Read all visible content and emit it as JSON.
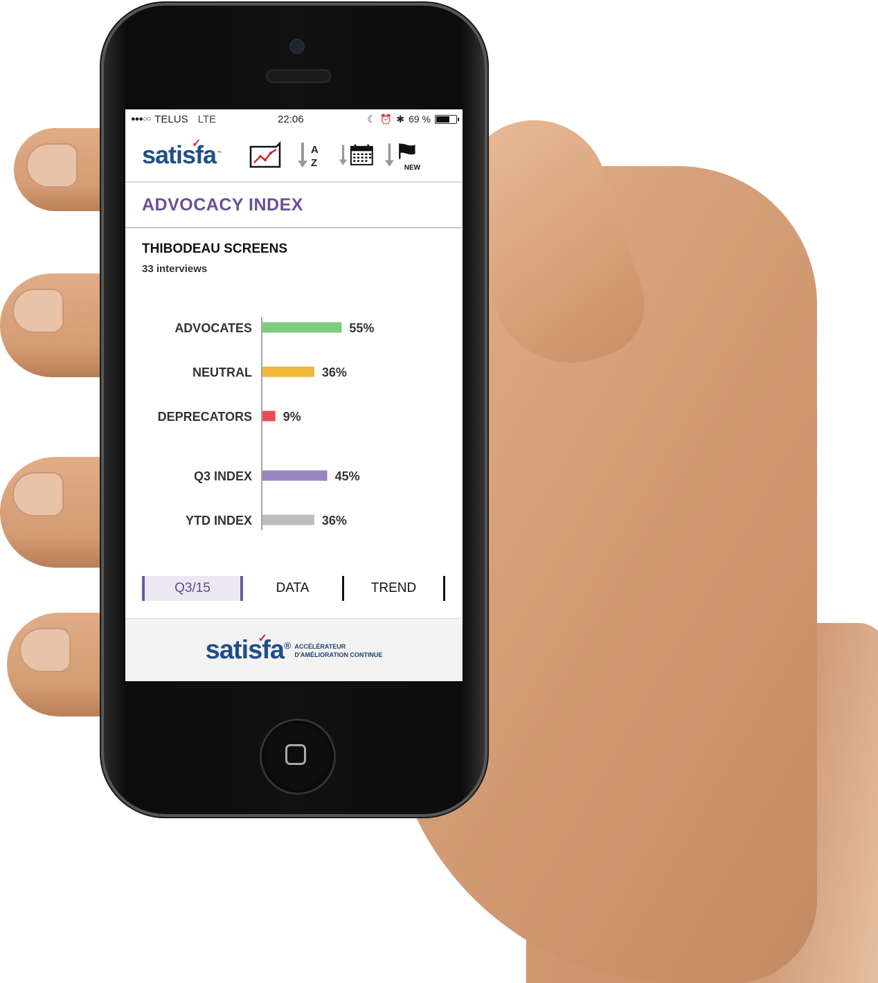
{
  "status_bar": {
    "signal": "●●●○○",
    "carrier": "TELUS",
    "network": "LTE",
    "time": "22:06",
    "battery_text": "69 %",
    "battery_level": 0.69
  },
  "toolbar": {
    "logo": "satisfa",
    "trademark": "™",
    "new_label": "NEW"
  },
  "page": {
    "title": "ADVOCACY INDEX",
    "store_name": "THIBODEAU SCREENS",
    "interviews": "33 interviews"
  },
  "chart_data": {
    "type": "bar",
    "orientation": "horizontal",
    "categories": [
      "ADVOCATES",
      "NEUTRAL",
      "DEPRECATORS",
      "Q3 INDEX",
      "YTD INDEX"
    ],
    "values": [
      55,
      36,
      9,
      45,
      36
    ],
    "value_labels": [
      "55%",
      "36%",
      "9%",
      "45%",
      "36%"
    ],
    "colors": [
      "#7ccb7f",
      "#f1b73c",
      "#ea4a55",
      "#9a84c2",
      "#bdbdbd"
    ],
    "xlim": [
      0,
      100
    ],
    "grid": false
  },
  "tabs": [
    {
      "label": "Q3/15",
      "selected": true
    },
    {
      "label": "DATA",
      "selected": false
    },
    {
      "label": "TREND",
      "selected": false
    }
  ],
  "footer": {
    "logo": "satisfa",
    "registered": "®",
    "tagline_line1": "ACCÉLÉRATEUR",
    "tagline_line2": "D'AMÉLIORATION CONTINUE"
  },
  "colors": {
    "brand_blue": "#1f4e8a",
    "brand_red": "#d6242a",
    "title_purple": "#6b4f96"
  }
}
